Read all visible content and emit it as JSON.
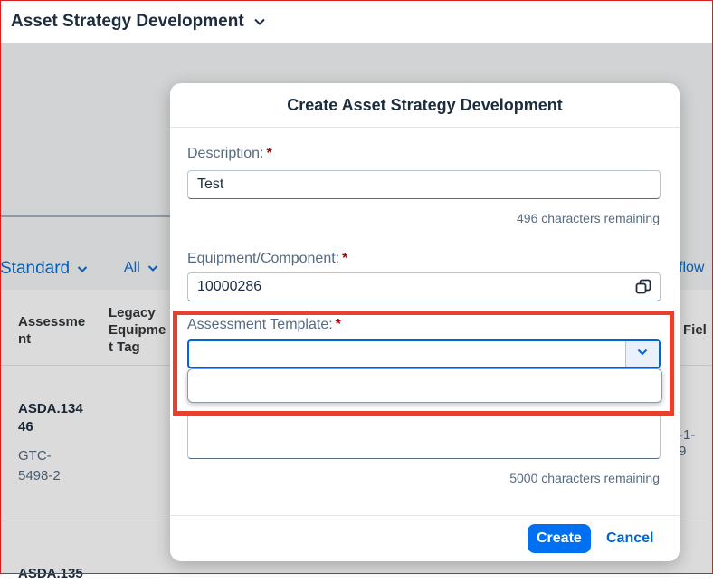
{
  "header": {
    "app_title": "Asset Strategy Development"
  },
  "background": {
    "variant_label": "Standard",
    "filter_label": "All",
    "right_link": "flow",
    "columns": [
      "Assessme nt",
      "Legacy Equipme t Tag",
      "Fiel"
    ],
    "rows": [
      {
        "id": "ASDA.134 46",
        "sub": "GTC- 5498-2",
        "right": "-1- 9"
      },
      {
        "id": "ASDA.135"
      }
    ]
  },
  "dialog": {
    "title": "Create Asset Strategy Development",
    "description": {
      "label": "Description:",
      "value": "Test",
      "counter": "496 characters remaining"
    },
    "equipment": {
      "label": "Equipment/Component:",
      "value": "10000286"
    },
    "template": {
      "label": "Assessment Template:",
      "value": ""
    },
    "notes_counter": "5000 characters remaining",
    "required_marker": "*",
    "buttons": {
      "create": "Create",
      "cancel": "Cancel"
    }
  },
  "colors": {
    "accent": "#0070f2",
    "highlight": "#e8402f",
    "required": "#aa0808"
  }
}
